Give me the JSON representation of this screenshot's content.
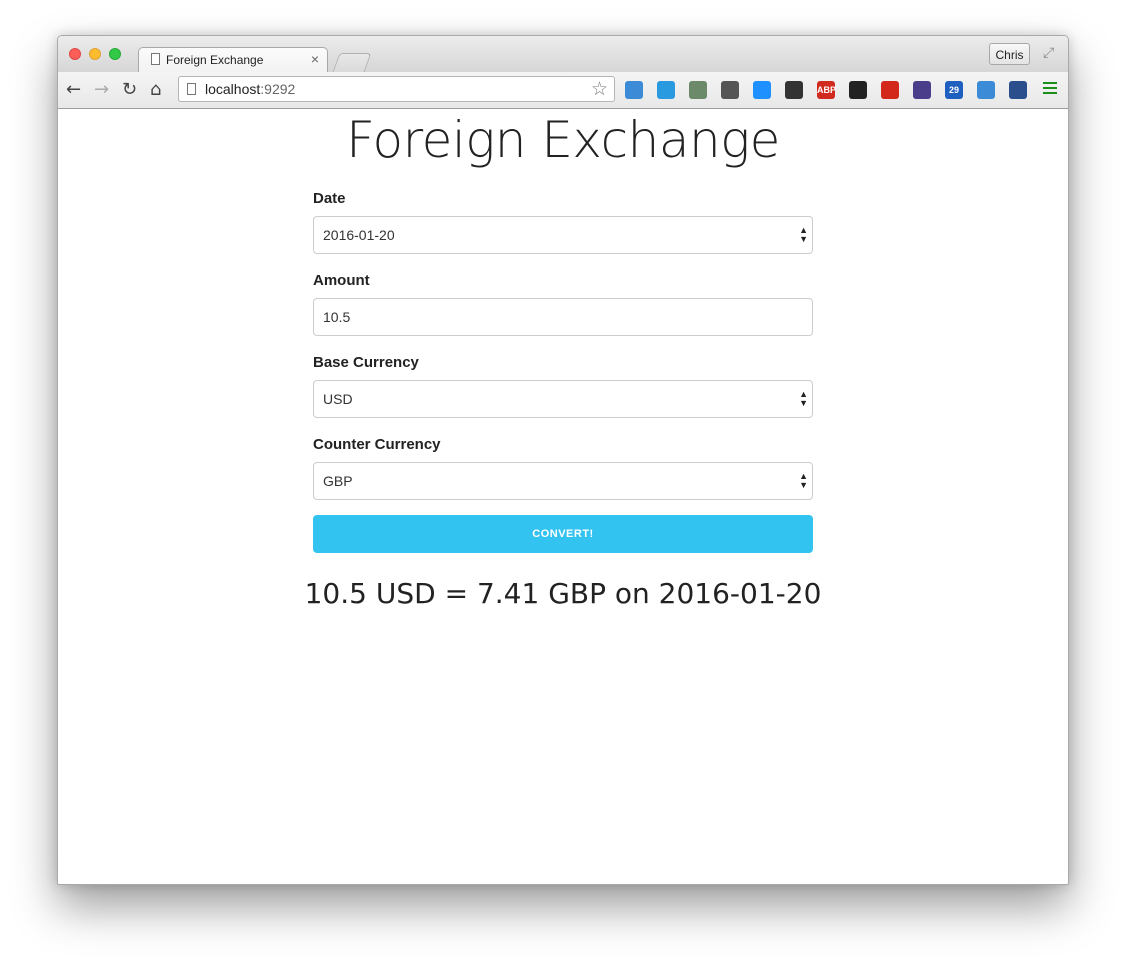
{
  "browser": {
    "tab_title": "Foreign Exchange",
    "tab_close": "×",
    "profile_name": "Chris",
    "url_host": "localhost",
    "url_port": ":9292"
  },
  "page": {
    "title": "Foreign Exchange",
    "date_label": "Date",
    "date_value": "2016-01-20",
    "amount_label": "Amount",
    "amount_value": "10.5",
    "base_label": "Base Currency",
    "base_value": "USD",
    "counter_label": "Counter Currency",
    "counter_value": "GBP",
    "convert_label": "CONVERT!",
    "result": "10.5 USD = 7.41 GBP on 2016-01-20"
  },
  "colors": {
    "accent": "#33c3f0"
  },
  "extensions": [
    {
      "icon": "chrome-ext-icon",
      "color": "#3b8bd6",
      "text": ""
    },
    {
      "icon": "folder-ext-icon",
      "color": "#2a9ae0",
      "text": ""
    },
    {
      "icon": "clipboard-ext-icon",
      "color": "#6a8a6a",
      "text": ""
    },
    {
      "icon": "pocket-ext-icon",
      "color": "#555555",
      "text": ""
    },
    {
      "icon": "shield-ext-icon",
      "color": "#1e90ff",
      "text": ""
    },
    {
      "icon": "gear-ext-icon",
      "color": "#333333",
      "text": ""
    },
    {
      "icon": "adblock-ext-icon",
      "color": "#d12a1f",
      "text": "ABP"
    },
    {
      "icon": "cat-ext-icon",
      "color": "#222222",
      "text": ""
    },
    {
      "icon": "heart-ext-icon",
      "color": "#d4271b",
      "text": ""
    },
    {
      "icon": "image-ext-icon",
      "color": "#4a3e8a",
      "text": ""
    },
    {
      "icon": "calendar-ext-icon",
      "color": "#1f5fbf",
      "text": "29"
    },
    {
      "icon": "tag-ext-icon",
      "color": "#3b8bd6",
      "text": ""
    },
    {
      "icon": "phone-ext-icon",
      "color": "#2b4e8c",
      "text": ""
    }
  ]
}
